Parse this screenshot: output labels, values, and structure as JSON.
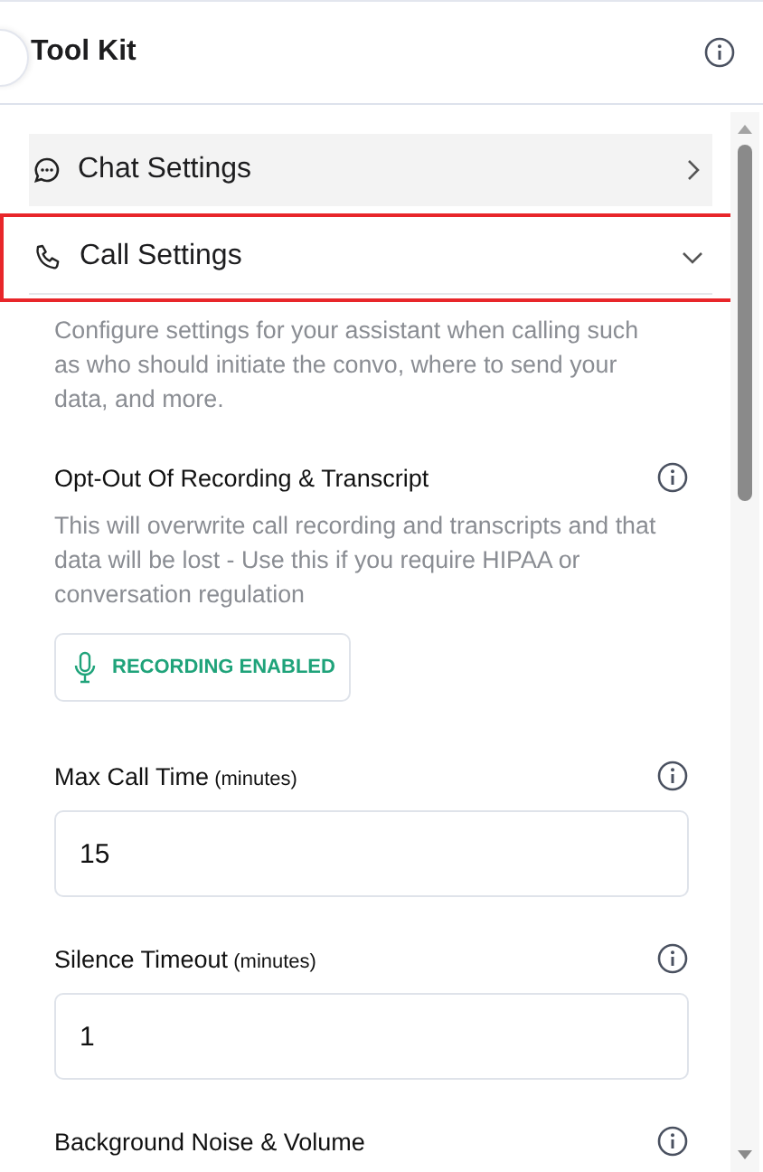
{
  "panel": {
    "title": "Tool Kit"
  },
  "sections": [
    {
      "title": "Chat Settings",
      "kind": "chat",
      "expanded": false,
      "highlighted": false
    },
    {
      "title": "Call Settings",
      "kind": "call",
      "expanded": true,
      "highlighted": true,
      "description": "Configure settings for your assistant when calling such as who should initiate the convo, where to send your data, and more.",
      "settings": [
        {
          "kind": "toggle",
          "label": "Opt-Out Of Recording & Transcript",
          "help": "This will overwrite call recording and transcripts and that data will be lost - Use this if you require HIPAA or conversation regulation",
          "button": "RECORDING ENABLED",
          "on": true
        },
        {
          "kind": "number",
          "label": "Max Call Time",
          "unit": "(minutes)",
          "value": "15"
        },
        {
          "kind": "number",
          "label": "Silence Timeout",
          "unit": "(minutes)",
          "value": "1"
        },
        {
          "kind": "heading",
          "label": "Background Noise & Volume"
        }
      ]
    }
  ]
}
